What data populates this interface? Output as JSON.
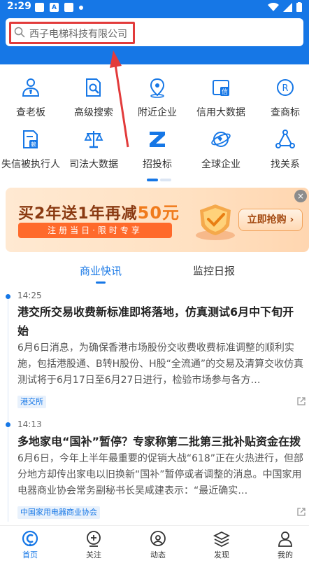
{
  "status_bar": {
    "time": "2:29"
  },
  "search": {
    "placeholder": "西子电梯科技有限公司"
  },
  "quick_grid": [
    {
      "label": "查老板",
      "icon": "person-badge-icon"
    },
    {
      "label": "高级搜索",
      "icon": "document-search-icon"
    },
    {
      "label": "附近企业",
      "icon": "location-pin-icon"
    },
    {
      "label": "信用大数据",
      "icon": "credit-report-icon"
    },
    {
      "label": "查商标",
      "icon": "registered-trademark-icon"
    },
    {
      "label": "失信被执行人",
      "icon": "dishonesty-document-icon"
    },
    {
      "label": "司法大数据",
      "icon": "scales-icon"
    },
    {
      "label": "招投标",
      "icon": "z-logo-icon"
    },
    {
      "label": "全球企业",
      "icon": "globe-icon"
    },
    {
      "label": "找关系",
      "icon": "network-triangle-icon"
    }
  ],
  "banner": {
    "title_part1": "买2年送1年再减",
    "title_amount": "50元",
    "subtitle": "注册当日·限时专享",
    "button": "立即抢购 ›",
    "close": "×"
  },
  "tabs": [
    {
      "label": "商业快讯",
      "active": true
    },
    {
      "label": "监控日报",
      "active": false
    }
  ],
  "news": [
    {
      "time": "14:25",
      "title": "港交所交易收费新标准即将落地，仿真测试6月中下旬开始",
      "body": "6月6日消息，为确保香港市场股份交收费收费标准调整的顺利实施，包括港股通、B转H股份、H股“全流通”的交易及清算交收仿真测试将于6月17日至6月27日进行，检验市场参与各方…",
      "tag": "港交所"
    },
    {
      "time": "14:13",
      "title": "多地家电“国补”暂停？专家称第二批第三批补贴资金在拨",
      "body": "6月6日，今年上半年最重要的促销大战“618”正在火热进行，但部分地方却传出家电以旧换新“国补”暂停或者调整的消息。中国家用电器商业协会常务副秘书长吴咸建表示：“最近确实…",
      "tag": "中国家用电器商业协会"
    }
  ],
  "bottom_nav": [
    {
      "label": "首页",
      "icon": "home-c-icon",
      "active": true
    },
    {
      "label": "关注",
      "icon": "plus-circle-icon",
      "active": false
    },
    {
      "label": "动态",
      "icon": "dynamic-icon",
      "active": false
    },
    {
      "label": "发现",
      "icon": "layers-icon",
      "active": false
    },
    {
      "label": "我的",
      "icon": "user-icon",
      "active": false
    }
  ],
  "colors": {
    "brand_blue": "#1677e6",
    "highlight_red": "#e23b3b",
    "banner_orange": "#ff6a2b"
  }
}
